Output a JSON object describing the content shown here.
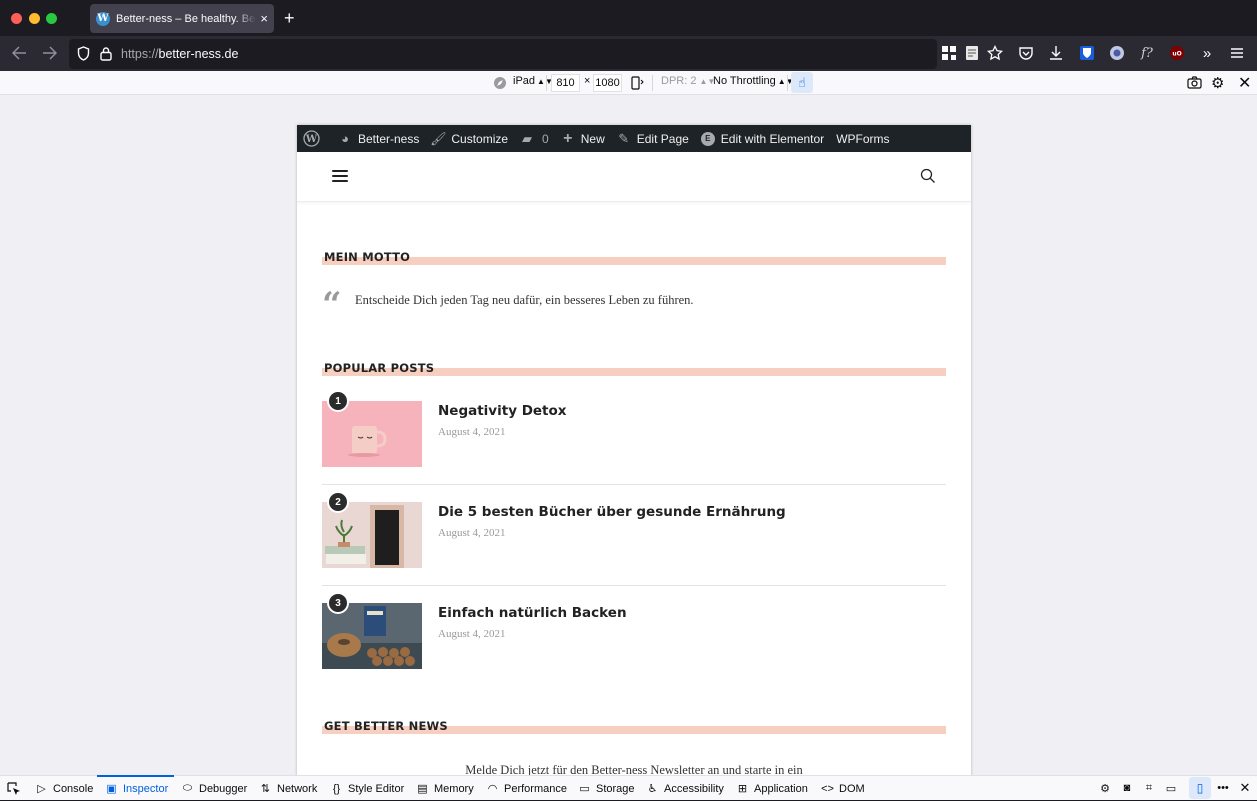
{
  "browser": {
    "tab_title": "Better-ness – Be healthy. Be happy.",
    "tab_close": "×",
    "new_tab": "+",
    "url_protocol": "https://",
    "url_host": "better-ness.de"
  },
  "rdm": {
    "device": "iPad",
    "width": "810",
    "times": "×",
    "height": "1080",
    "dpr": "DPR: 2",
    "throttling": "No Throttling"
  },
  "wp_admin_bar": {
    "site_name": "Better-ness",
    "customize": "Customize",
    "comments_count": "0",
    "new": "New",
    "edit_page": "Edit Page",
    "elementor": "Edit with Elementor",
    "wpforms": "WPForms"
  },
  "page": {
    "motto_title": "MEIN MOTTO",
    "motto_quote": "Entscheide Dich jeden Tag neu dafür, ein besseres Leben zu führen.",
    "popular_title": "POPULAR POSTS",
    "posts": [
      {
        "rank": "1",
        "title": "Negativity Detox",
        "date": "August 4, 2021"
      },
      {
        "rank": "2",
        "title": "Die 5 besten Bücher über gesunde Ernährung",
        "date": "August 4, 2021"
      },
      {
        "rank": "3",
        "title": "Einfach natürlich Backen",
        "date": "August 4, 2021"
      }
    ],
    "news_title": "GET BETTER NEWS",
    "news_text": "Melde Dich jetzt für den Better-ness Newsletter an und starte in ein"
  },
  "devtools": {
    "tabs": [
      "Console",
      "Inspector",
      "Debugger",
      "Network",
      "Style Editor",
      "Memory",
      "Performance",
      "Storage",
      "Accessibility",
      "Application",
      "DOM"
    ],
    "active_tab": "Inspector"
  },
  "colors": {
    "accent_underline": "#f6cfc0",
    "devtools_active": "#0061e0",
    "wp_bar": "#1d2327"
  }
}
